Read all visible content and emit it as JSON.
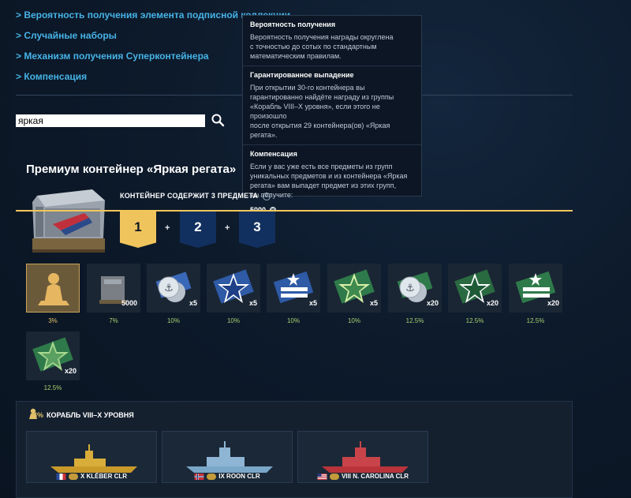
{
  "links": [
    "> Вероятность получения элемента подписной коллекции",
    "> Случайные наборы",
    "> Механизм получения Суперконтейнера",
    "> Компенсация"
  ],
  "search": {
    "value": "яркая"
  },
  "tooltip": {
    "sections": [
      {
        "heading": "Вероятность получения",
        "lines": [
          "Вероятность получения награды округлена",
          "с точностью до сотых по стандартным",
          "математическим правилам."
        ]
      },
      {
        "heading": "Гарантированное выпадение",
        "lines": [
          "При открытии 30-го контейнера вы",
          "гарантированно найдёте награду из группы",
          "«Корабль VIII–X уровня», если этого не произошло",
          "после открытия 29 контейнера(ов) «Яркая регата»."
        ]
      },
      {
        "heading": "Компенсация",
        "lines": [
          "Если у вас уже есть все предметы из групп",
          "уникальных предметов и из контейнера «Яркая",
          "регата» вам выпадет предмет из этих групп,",
          "вы получите:"
        ],
        "amount": "5000"
      }
    ]
  },
  "container": {
    "title": "Премиум контейнер «Яркая регата»",
    "contains": "КОНТЕЙНЕР СОДЕРЖИТ 3 ПРЕДМЕТА",
    "groups": [
      "1",
      "2",
      "3"
    ],
    "plus": "+"
  },
  "rewards": [
    {
      "icon": "ship-silhouette-icon",
      "qty": "",
      "pct": "3%"
    },
    {
      "icon": "container-icon",
      "qty": "5000",
      "pct": "7%"
    },
    {
      "icon": "anchor-coins-icon",
      "qty": "x5",
      "pct": "10%"
    },
    {
      "icon": "blue-star-icon",
      "qty": "x5",
      "pct": "10%"
    },
    {
      "icon": "blue-flag-star-icon",
      "qty": "x5",
      "pct": "10%"
    },
    {
      "icon": "green-star-icon",
      "qty": "x5",
      "pct": "10%"
    },
    {
      "icon": "anchor-coins-green-icon",
      "qty": "x20",
      "pct": "12.5%"
    },
    {
      "icon": "dark-green-star-icon",
      "qty": "x20",
      "pct": "12.5%"
    },
    {
      "icon": "green-flag-star-icon",
      "qty": "x20",
      "pct": "12.5%"
    },
    {
      "icon": "light-green-star-icon",
      "qty": "x20",
      "pct": "12.5%"
    }
  ],
  "ship_group": {
    "percent": "3%",
    "label": "КОРАБЛЬ VIII–X УРОВНЯ"
  },
  "ships": [
    {
      "name": "X KLÉBER CLR",
      "flag": "france-flag-icon",
      "hull": "#c99a2a"
    },
    {
      "name": "IX ROON CLR",
      "flag": "norway-flag-icon",
      "hull": "#7aa6c8"
    },
    {
      "name": "VIII N. CAROLINA CLR",
      "flag": "usa-flag-icon",
      "hull": "#b8343a"
    }
  ]
}
